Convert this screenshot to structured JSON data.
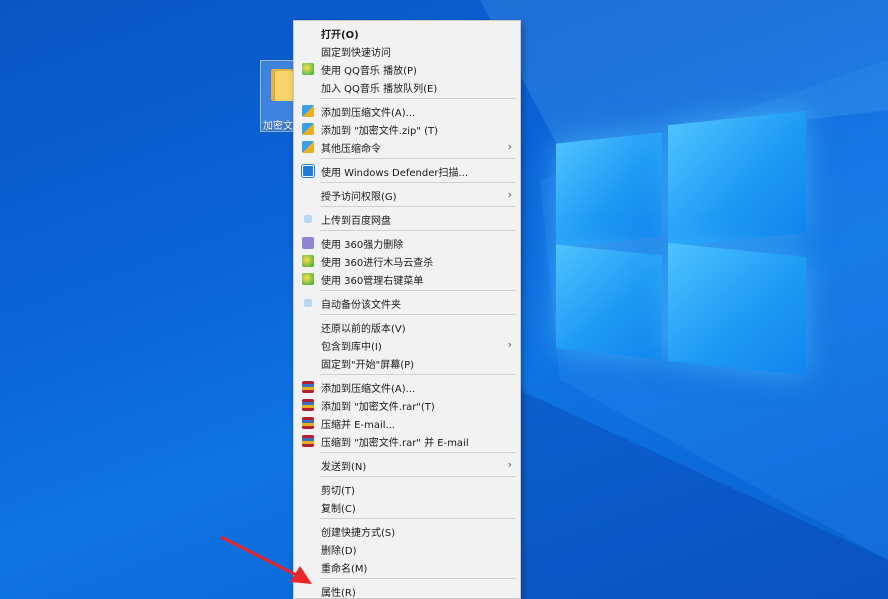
{
  "desktop": {
    "folder": {
      "label": "加密文件"
    }
  },
  "context_menu": {
    "items": [
      {
        "label": "打开(O)",
        "bold": true,
        "icon": ""
      },
      {
        "label": "固定到快速访问",
        "icon": ""
      },
      {
        "label": "使用 QQ音乐 播放(P)",
        "icon": "qq-music-icon"
      },
      {
        "label": "加入 QQ音乐 播放队列(E)",
        "icon": ""
      },
      {
        "sep": true
      },
      {
        "label": "添加到压缩文件(A)...",
        "icon": "compress-icon"
      },
      {
        "label": "添加到 \"加密文件.zip\" (T)",
        "icon": "compress-icon"
      },
      {
        "label": "其他压缩命令",
        "icon": "compress-icon",
        "submenu": true
      },
      {
        "sep": true
      },
      {
        "label": "使用 Windows Defender扫描...",
        "icon": "defender-icon"
      },
      {
        "sep": true
      },
      {
        "label": "授予访问权限(G)",
        "icon": "",
        "submenu": true
      },
      {
        "sep": true
      },
      {
        "label": "上传到百度网盘",
        "icon": "cloud-icon"
      },
      {
        "sep": true
      },
      {
        "label": "使用 360强力删除",
        "icon": "360-delete-icon"
      },
      {
        "label": "使用 360进行木马云查杀",
        "icon": "360-icon"
      },
      {
        "label": "使用 360管理右键菜单",
        "icon": "360-icon"
      },
      {
        "sep": true
      },
      {
        "label": "自动备份该文件夹",
        "icon": "cloud-icon"
      },
      {
        "sep": true
      },
      {
        "label": "还原以前的版本(V)",
        "icon": ""
      },
      {
        "label": "包含到库中(I)",
        "icon": "",
        "submenu": true
      },
      {
        "label": "固定到\"开始\"屏幕(P)",
        "icon": ""
      },
      {
        "sep": true
      },
      {
        "label": "添加到压缩文件(A)...",
        "icon": "winrar-icon"
      },
      {
        "label": "添加到 \"加密文件.rar\"(T)",
        "icon": "winrar-icon"
      },
      {
        "label": "压缩并 E-mail...",
        "icon": "winrar-icon"
      },
      {
        "label": "压缩到 \"加密文件.rar\" 并 E-mail",
        "icon": "winrar-icon"
      },
      {
        "sep": true
      },
      {
        "label": "发送到(N)",
        "icon": "",
        "submenu": true
      },
      {
        "sep": true
      },
      {
        "label": "剪切(T)",
        "icon": ""
      },
      {
        "label": "复制(C)",
        "icon": ""
      },
      {
        "sep": true
      },
      {
        "label": "创建快捷方式(S)",
        "icon": ""
      },
      {
        "label": "删除(D)",
        "icon": ""
      },
      {
        "label": "重命名(M)",
        "icon": ""
      },
      {
        "sep": true
      },
      {
        "label": "属性(R)",
        "icon": ""
      }
    ]
  },
  "annotation_color": "#e8262a"
}
